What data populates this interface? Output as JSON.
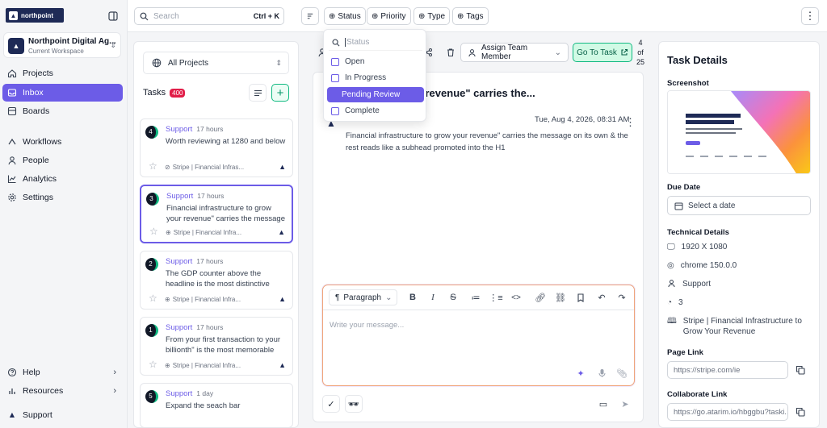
{
  "sidebar": {
    "logo_text": "northpoint",
    "workspace_name": "Northpoint Digital Ag...",
    "workspace_sub": "Current Workspace",
    "nav_primary": [
      "Projects",
      "Inbox",
      "Boards"
    ],
    "nav_secondary": [
      "Workflows",
      "People",
      "Analytics",
      "Settings"
    ],
    "nav_bottom": [
      "Help",
      "Resources"
    ],
    "support": "Support"
  },
  "topbar": {
    "search_placeholder": "Search",
    "search_shortcut": "Ctrl + K",
    "filters": [
      "Status",
      "Priority",
      "Type",
      "Tags"
    ]
  },
  "status_dropdown": {
    "search_placeholder": "Status",
    "options": [
      "Open",
      "In Progress",
      "Pending Review",
      "Complete"
    ],
    "highlighted": "Pending Review"
  },
  "task_list": {
    "project_select": "All Projects",
    "title": "Tasks",
    "count": "400",
    "cards": [
      {
        "num": "4",
        "category": "Support",
        "time": "17 hours",
        "desc": "Worth reviewing at 1280 and below",
        "source": "Stripe | Financial Infras..."
      },
      {
        "num": "3",
        "category": "Support",
        "time": "17 hours",
        "desc": "Financial infrastructure to grow your revenue\" carries the message on its...",
        "source": "Stripe | Financial Infra..."
      },
      {
        "num": "2",
        "category": "Support",
        "time": "17 hours",
        "desc": "The GDP counter above the headline is the most distinctive thing on the...",
        "source": "Stripe | Financial Infra..."
      },
      {
        "num": "1",
        "category": "Support",
        "time": "17 hours",
        "desc": "From your first transaction to your billionth\" is the most memorable line...",
        "source": "Stripe | Financial Infra..."
      },
      {
        "num": "5",
        "category": "Support",
        "time": "1 day",
        "desc": "Expand the seach bar",
        "source": ""
      }
    ]
  },
  "toolbar": {
    "assign_label": "Assign Team Member",
    "goto_label": "Go To Task",
    "pager_line1": "4",
    "pager_line2": "of",
    "pager_line3": "25"
  },
  "task": {
    "title": "ture to grow your revenue\" carries the...",
    "date": "Tue, Aug 4, 2026, 08:31 AM",
    "message": "Financial infrastructure to grow your revenue\" carries the message on its own & the rest reads like a subhead promoted into the H1"
  },
  "editor": {
    "block_type": "Paragraph",
    "placeholder": "Write your message..."
  },
  "details": {
    "heading": "Task Details",
    "screenshot_label": "Screenshot",
    "due_label": "Due Date",
    "due_placeholder": "Select a date",
    "tech_label": "Technical Details",
    "resolution": "1920 X 1080",
    "browser": "chrome 150.0.0",
    "type": "Support",
    "priority_num": "3",
    "page_title": "Stripe | Financial Infrastructure to Grow Your Revenue",
    "page_link_label": "Page Link",
    "page_link": "https://stripe.com/ie",
    "collab_label": "Collaborate Link",
    "collab_link": "https://go.atarim.io/hbggbu?taski..."
  },
  "colors": {
    "accent": "#6c5ce7",
    "brand": "#1e2a56",
    "badge": "#e11d48",
    "success": "#10b981"
  }
}
